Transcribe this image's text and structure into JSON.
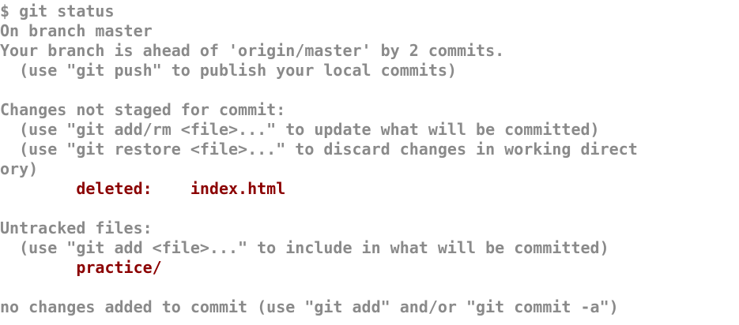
{
  "terminal": {
    "lines": [
      {
        "text": "$ git status"
      },
      {
        "text": "On branch master"
      },
      {
        "text": "Your branch is ahead of 'origin/master' by 2 commits."
      },
      {
        "text": "  (use \"git push\" to publish your local commits)"
      },
      {
        "text": ""
      },
      {
        "text": "Changes not staged for commit:"
      },
      {
        "text": "  (use \"git add/rm <file>...\" to update what will be committed)"
      },
      {
        "text": "  (use \"git restore <file>...\" to discard changes in working direct"
      },
      {
        "text": "ory)"
      },
      {
        "prefix": "        ",
        "red_text": "deleted:    index.html"
      },
      {
        "text": ""
      },
      {
        "text": "Untracked files:"
      },
      {
        "text": "  (use \"git add <file>...\" to include in what will be committed)"
      },
      {
        "prefix": "        ",
        "red_text": "practice/"
      },
      {
        "text": ""
      },
      {
        "text": "no changes added to commit (use \"git add\" and/or \"git commit -a\")"
      }
    ],
    "colors": {
      "background": "#ffffff",
      "text": "#8a8a8a",
      "highlight": "#8b0000"
    }
  }
}
